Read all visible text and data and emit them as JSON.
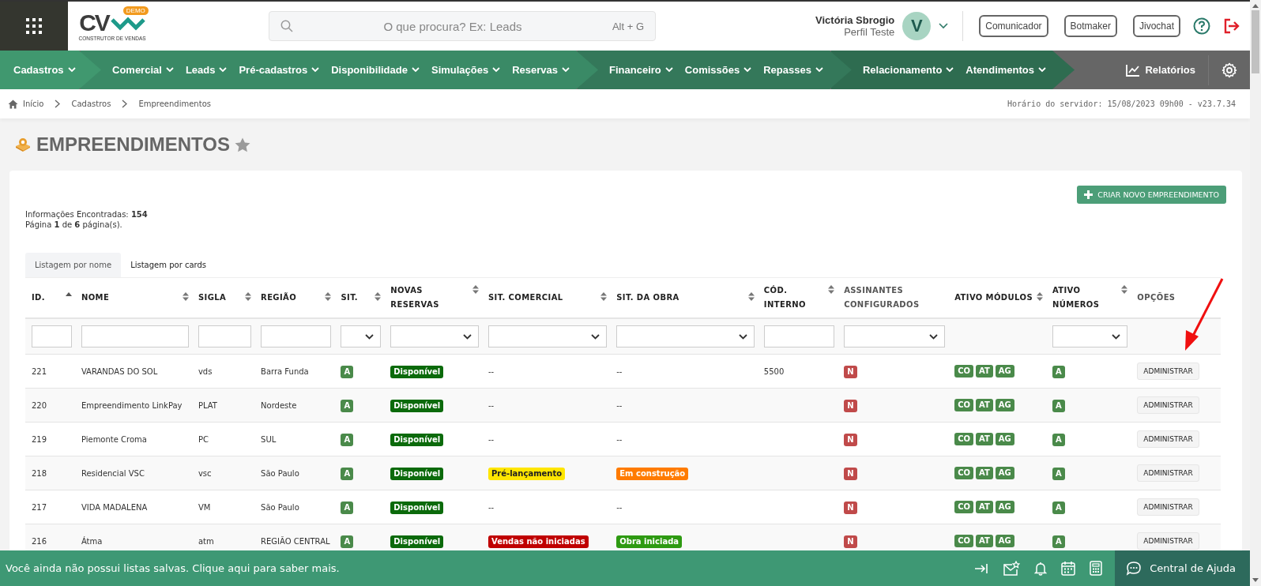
{
  "header": {
    "logo": {
      "text": "CV",
      "badge": "DEMO",
      "tagline": "CONSTRUTOR DE VENDAS"
    },
    "search": {
      "placeholder": "O que procura? Ex: Leads",
      "shortcut": "Alt + G"
    },
    "user": {
      "name": "Victória Sbrogio",
      "profile": "Perfil Teste",
      "initial": "V"
    },
    "buttons": [
      "Comunicador",
      "Botmaker",
      "Jivochat"
    ]
  },
  "nav": {
    "groups": [
      {
        "items": [
          "Cadastros"
        ]
      },
      {
        "items": [
          "Comercial",
          "Leads",
          "Pré-cadastros",
          "Disponibilidade",
          "Simulações",
          "Reservas"
        ]
      },
      {
        "items": [
          "Financeiro",
          "Comissões",
          "Repasses"
        ]
      },
      {
        "items": [
          "Relacionamento",
          "Atendimentos"
        ]
      }
    ],
    "reports": "Relatórios"
  },
  "breadcrumb": [
    "Início",
    "Cadastros",
    "Empreendimentos"
  ],
  "server_time": "Horário do servidor: 15/08/2023 09h00 - v23.7.34",
  "page_title": "EMPREENDIMENTOS",
  "create_button": "CRIAR NOVO EMPREENDIMENTO",
  "info": [
    "Informações Encontradas: **154**",
    "Página **1** de **6** página(s)."
  ],
  "tabs": [
    {
      "label": "Listagem por nome",
      "selected": true
    },
    {
      "label": "Listagem por cards",
      "selected": false
    }
  ],
  "table": {
    "columns": [
      {
        "label": "ID.",
        "sortable": true,
        "sorted": true,
        "filter": {
          "kind": "text"
        }
      },
      {
        "label": "NOME",
        "sortable": true,
        "sorted": false,
        "filter": {
          "kind": "text"
        }
      },
      {
        "label": "SIGLA",
        "sortable": true,
        "sorted": false,
        "filter": {
          "kind": "text"
        }
      },
      {
        "label": "REGIÃO",
        "sortable": true,
        "sorted": false,
        "filter": {
          "kind": "text"
        }
      },
      {
        "label": "SIT.",
        "sortable": true,
        "sorted": false,
        "filter": {
          "kind": "select"
        }
      },
      {
        "label": "NOVAS RESERVAS",
        "sortable": true,
        "sorted": false,
        "filter": {
          "kind": "select"
        }
      },
      {
        "label": "SIT. COMERCIAL",
        "sortable": true,
        "sorted": false,
        "filter": {
          "kind": "select"
        }
      },
      {
        "label": "SIT. DA OBRA",
        "sortable": true,
        "sorted": false,
        "filter": {
          "kind": "select"
        }
      },
      {
        "label": "CÓD. INTERNO",
        "sortable": true,
        "sorted": false,
        "filter": {
          "kind": "text"
        }
      },
      {
        "label": "ASSINANTES CONFIGURADOS",
        "sortable": false,
        "filter": {
          "kind": "select"
        }
      },
      {
        "label": "ATIVO MÓDULOS",
        "sortable": true,
        "sorted": false
      },
      {
        "label": "ATIVO NÚMEROS",
        "sortable": true,
        "sorted": false,
        "filter": {
          "kind": "select"
        }
      },
      {
        "label": "OPÇÕES",
        "sortable": false
      }
    ],
    "rows": [
      {
        "id": "221",
        "nome": "VARANDAS DO SOL",
        "sigla": "vds",
        "regiao": "Barra Funda",
        "sit": {
          "text": "A",
          "color": "#4a8a4a"
        },
        "novas": {
          "text": "Disponível",
          "color": "#0b6a0b"
        },
        "comercial": "--",
        "obra": "--",
        "cod": "5500",
        "assinantes": {
          "text": "N",
          "color": "#c04a4a"
        },
        "modulos": [
          {
            "text": "CO",
            "color": "#4a8a4a"
          },
          {
            "text": "AT",
            "color": "#4a8a4a"
          },
          {
            "text": "AG",
            "color": "#4a8a4a"
          }
        ],
        "numeros": {
          "text": "A",
          "color": "#4a8a4a"
        },
        "opcoes": "ADMINISTRAR"
      },
      {
        "id": "220",
        "nome": "Empreendimento LinkPay",
        "sigla": "PLAT",
        "regiao": "Nordeste",
        "sit": {
          "text": "A",
          "color": "#4a8a4a"
        },
        "novas": {
          "text": "Disponível",
          "color": "#0b6a0b"
        },
        "comercial": "--",
        "obra": "--",
        "assinantes": {
          "text": "N",
          "color": "#c04a4a"
        },
        "modulos": [
          {
            "text": "CO",
            "color": "#4a8a4a"
          },
          {
            "text": "AT",
            "color": "#4a8a4a"
          },
          {
            "text": "AG",
            "color": "#4a8a4a"
          }
        ],
        "numeros": {
          "text": "A",
          "color": "#4a8a4a"
        },
        "opcoes": "ADMINISTRAR"
      },
      {
        "id": "219",
        "nome": "Piemonte Croma",
        "sigla": "PC",
        "regiao": "SUL",
        "sit": {
          "text": "A",
          "color": "#4a8a4a"
        },
        "novas": {
          "text": "Disponível",
          "color": "#0b6a0b"
        },
        "comercial": "--",
        "obra": "--",
        "assinantes": {
          "text": "N",
          "color": "#c04a4a"
        },
        "modulos": [
          {
            "text": "CO",
            "color": "#4a8a4a"
          },
          {
            "text": "AT",
            "color": "#4a8a4a"
          },
          {
            "text": "AG",
            "color": "#4a8a4a"
          }
        ],
        "numeros": {
          "text": "A",
          "color": "#4a8a4a"
        },
        "opcoes": "ADMINISTRAR"
      },
      {
        "id": "218",
        "nome": "Residencial VSC",
        "sigla": "vsc",
        "regiao": "São Paulo",
        "sit": {
          "text": "A",
          "color": "#4a8a4a"
        },
        "novas": {
          "text": "Disponível",
          "color": "#0b6a0b"
        },
        "comercial": {
          "text": "Pré-lançamento",
          "color": "#ffe600"
        },
        "obra": {
          "text": "Em construção",
          "color": "#ff7b00"
        },
        "assinantes": {
          "text": "N",
          "color": "#c04a4a"
        },
        "modulos": [
          {
            "text": "CO",
            "color": "#4a8a4a"
          },
          {
            "text": "AT",
            "color": "#4a8a4a"
          },
          {
            "text": "AG",
            "color": "#4a8a4a"
          }
        ],
        "numeros": {
          "text": "A",
          "color": "#4a8a4a"
        },
        "opcoes": "ADMINISTRAR"
      },
      {
        "id": "217",
        "nome": "VIDA MADALENA",
        "sigla": "VM",
        "regiao": "São Paulo",
        "sit": {
          "text": "A",
          "color": "#4a8a4a"
        },
        "novas": {
          "text": "Disponível",
          "color": "#0b6a0b"
        },
        "comercial": "--",
        "obra": "--",
        "assinantes": {
          "text": "N",
          "color": "#c04a4a"
        },
        "modulos": [
          {
            "text": "CO",
            "color": "#4a8a4a"
          },
          {
            "text": "AT",
            "color": "#4a8a4a"
          },
          {
            "text": "AG",
            "color": "#4a8a4a"
          }
        ],
        "numeros": {
          "text": "A",
          "color": "#4a8a4a"
        },
        "opcoes": "ADMINISTRAR"
      },
      {
        "id": "216",
        "nome": "Átma",
        "sigla": "atm",
        "regiao": "REGIÃO CENTRAL",
        "sit": {
          "text": "A",
          "color": "#4a8a4a"
        },
        "novas": {
          "text": "Disponível",
          "color": "#0b6a0b"
        },
        "comercial": {
          "text": "Vendas não iniciadas",
          "color": "#c00000"
        },
        "obra": {
          "text": "Obra iniciada",
          "color": "#2e9a12"
        },
        "assinantes": {
          "text": "N",
          "color": "#c04a4a"
        },
        "modulos": [
          {
            "text": "CO",
            "color": "#4a8a4a"
          },
          {
            "text": "AT",
            "color": "#4a8a4a"
          },
          {
            "text": "AG",
            "color": "#4a8a4a"
          }
        ],
        "numeros": {
          "text": "A",
          "color": "#4a8a4a"
        },
        "opcoes": "ADMINISTRAR"
      }
    ]
  },
  "footer": {
    "message": "Você ainda não possui listas salvas. Clique aqui para saber mais.",
    "help": "Central de Ajuda"
  }
}
